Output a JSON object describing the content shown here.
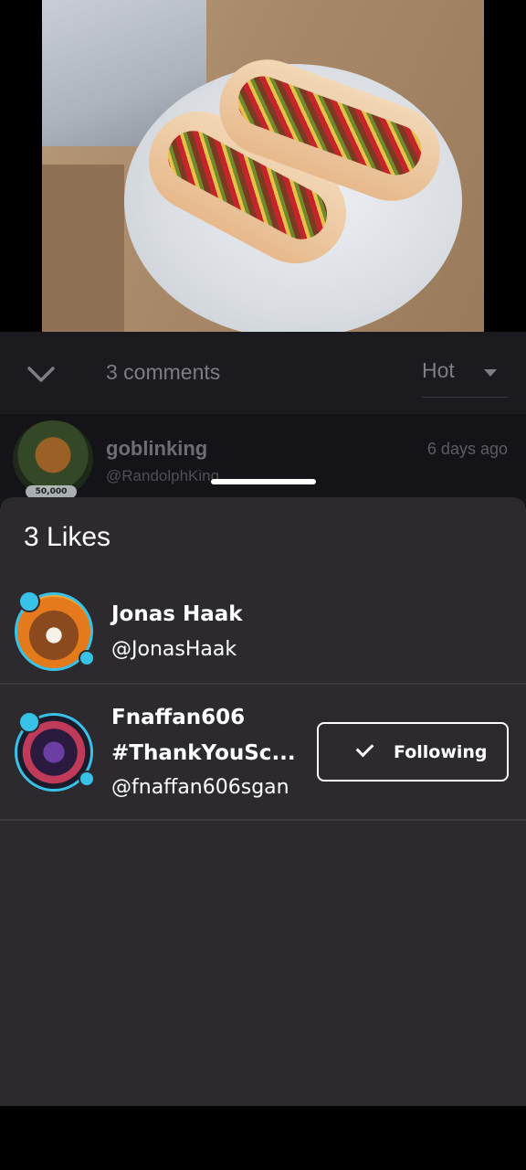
{
  "post": {
    "image_alt": "photo of two hot dogs on a plate"
  },
  "comments_bar": {
    "count_label": "3 comments",
    "sort_label": "Hot"
  },
  "comment_preview": {
    "name": "goblinking",
    "handle": "@RandolphKing",
    "time": "6 days ago",
    "badge": "50,000"
  },
  "likes_sheet": {
    "title": "3 Likes",
    "users": [
      {
        "name": "Jonas Haak",
        "handle": "@JonasHaak"
      },
      {
        "name_line1": "Fnaffan606",
        "name_line2": "#ThankYouSc...",
        "handle": "@fnaffan606sgan",
        "follow_label": "Following"
      }
    ]
  },
  "colors": {
    "accent_ring": "#38c2e8",
    "sheet_bg": "#2c2a2f"
  }
}
